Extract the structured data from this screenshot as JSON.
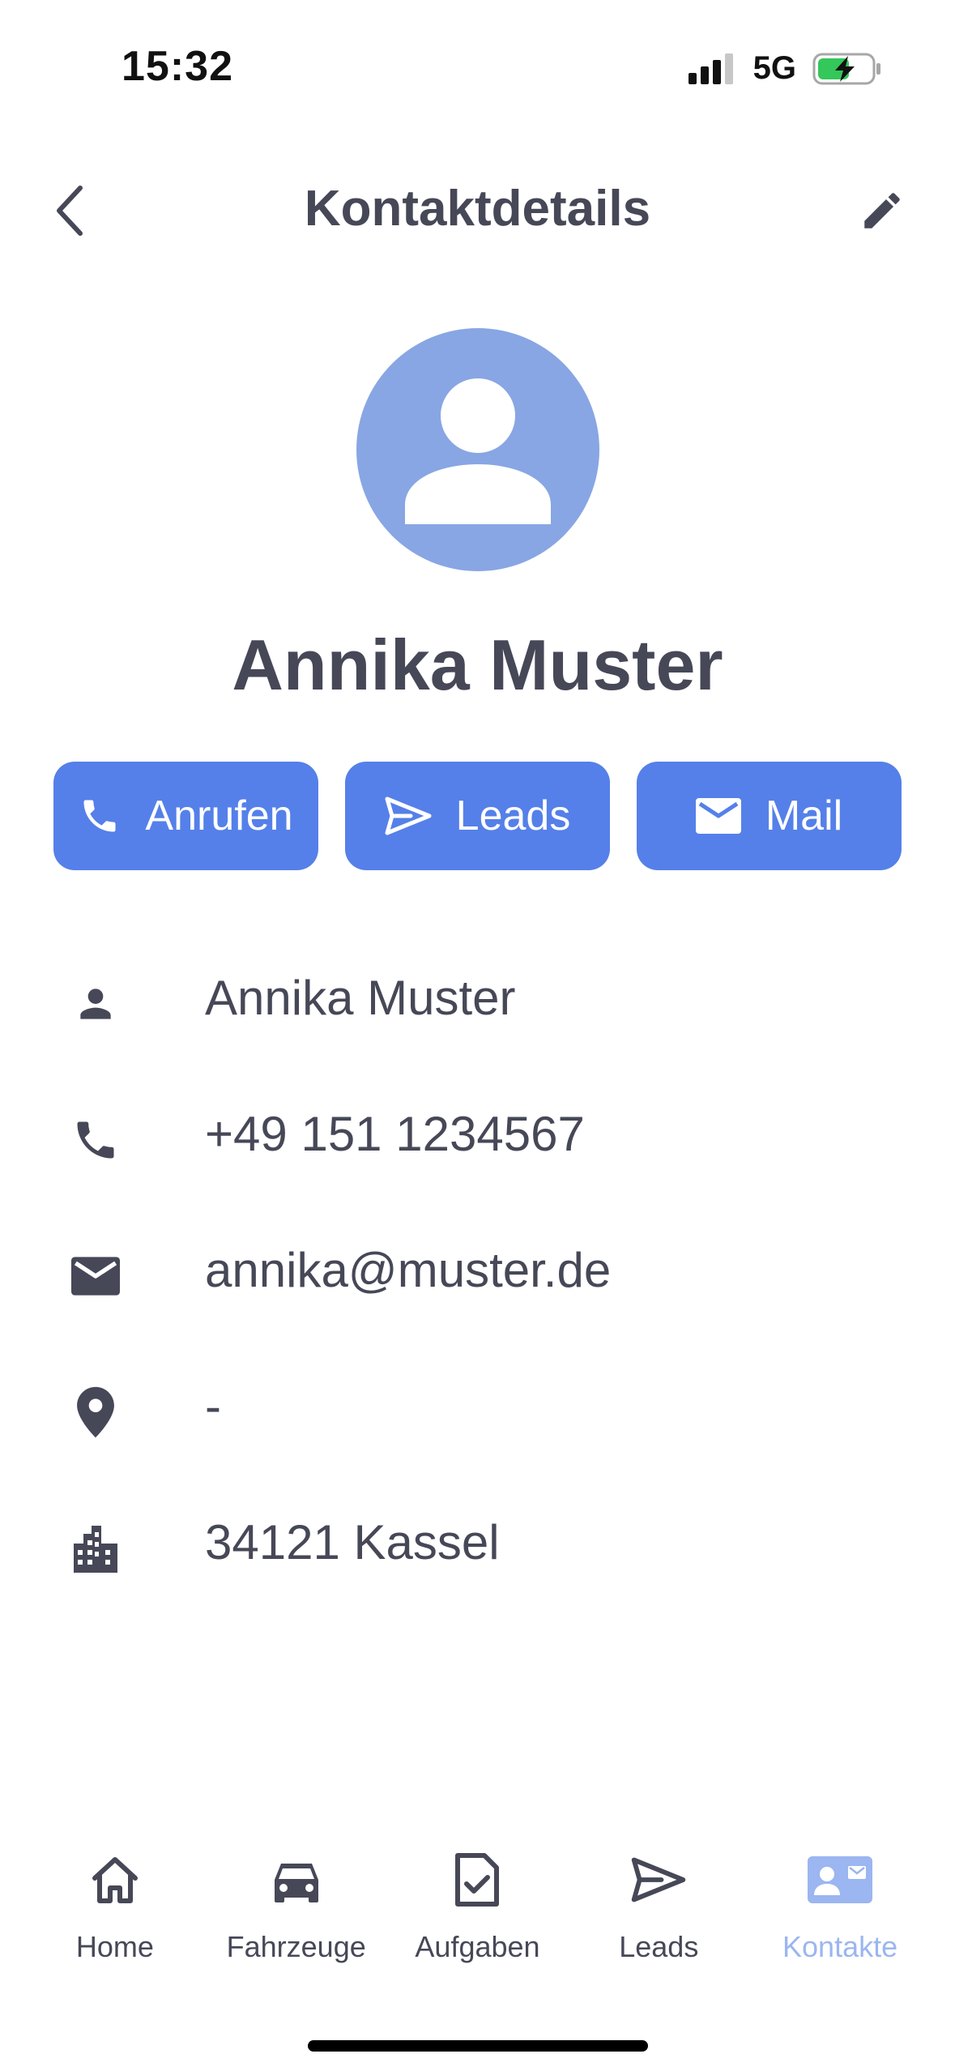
{
  "status_bar": {
    "time": "15:32",
    "network": "5G"
  },
  "header": {
    "title": "Kontaktdetails",
    "back_icon": "chevron-left-icon",
    "edit_icon": "pencil-icon"
  },
  "contact": {
    "name": "Annika Muster",
    "avatar_icon": "person-icon",
    "avatar_color": "#88a6e3"
  },
  "actions": [
    {
      "label": "Anrufen",
      "icon": "phone-icon"
    },
    {
      "label": "Leads",
      "icon": "send-icon"
    },
    {
      "label": "Mail",
      "icon": "mail-icon"
    }
  ],
  "details": [
    {
      "icon": "person-icon",
      "value": "Annika Muster"
    },
    {
      "icon": "phone-icon",
      "value": "+49 151 1234567"
    },
    {
      "icon": "mail-icon",
      "value": "annika@muster.de"
    },
    {
      "icon": "location-pin-icon",
      "value": "-"
    },
    {
      "icon": "city-icon",
      "value": "34121 Kassel"
    }
  ],
  "nav": [
    {
      "label": "Home",
      "icon": "home-icon",
      "active": false
    },
    {
      "label": "Fahrzeuge",
      "icon": "car-icon",
      "active": false
    },
    {
      "label": "Aufgaben",
      "icon": "task-document-icon",
      "active": false
    },
    {
      "label": "Leads",
      "icon": "send-icon",
      "active": false
    },
    {
      "label": "Kontakte",
      "icon": "contact-card-icon",
      "active": true
    }
  ],
  "colors": {
    "accent": "#5580e9",
    "text": "#464857",
    "nav_active": "#9bb6f0"
  }
}
